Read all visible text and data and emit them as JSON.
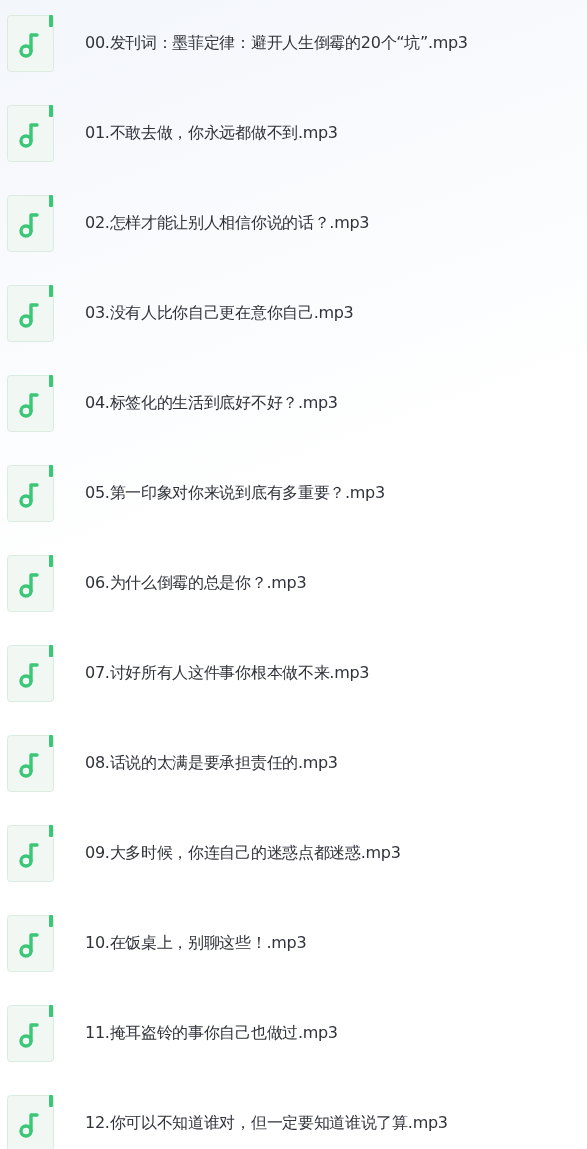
{
  "files": [
    {
      "name": "00.发刊词：墨菲定律：避开人生倒霉的20个“坑”.mp3"
    },
    {
      "name": "01.不敢去做，你永远都做不到.mp3"
    },
    {
      "name": "02.怎样才能让别人相信你说的话？.mp3"
    },
    {
      "name": "03.没有人比你自己更在意你自己.mp3"
    },
    {
      "name": "04.标签化的生活到底好不好？.mp3"
    },
    {
      "name": "05.第一印象对你来说到底有多重要？.mp3"
    },
    {
      "name": "06.为什么倒霉的总是你？.mp3"
    },
    {
      "name": "07.讨好所有人这件事你根本做不来.mp3"
    },
    {
      "name": "08.话说的太满是要承担责任的.mp3"
    },
    {
      "name": "09.大多时候，你连自己的迷惑点都迷惑.mp3"
    },
    {
      "name": "10.在饭桌上，别聊这些！.mp3"
    },
    {
      "name": "11.掩耳盗铃的事你自己也做过.mp3"
    },
    {
      "name": "12.你可以不知道谁对，但一定要知道谁说了算.mp3"
    }
  ]
}
